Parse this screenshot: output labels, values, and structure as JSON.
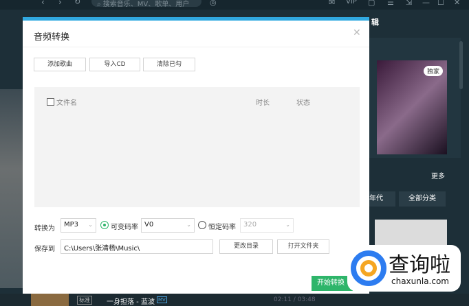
{
  "topbar": {
    "search_placeholder": "搜索音乐、MV、歌单、用户",
    "vip": "VIP"
  },
  "right_panel": {
    "section_title_partial": "辑",
    "badge": "独家",
    "more": "更多",
    "categories": [
      "年代",
      "全部分类"
    ]
  },
  "dialog": {
    "title": "音频转换",
    "toolbar": [
      "添加歌曲",
      "导入CD",
      "清除已勾"
    ],
    "columns": {
      "filename": "文件名",
      "duration": "时长",
      "status": "状态"
    },
    "convert_label": "转换为",
    "format": "MP3",
    "vbr_label": "可变码率",
    "vbr_value": "V0",
    "vbr_selected": true,
    "cbr_label": "恒定码率",
    "cbr_value": "320",
    "save_label": "保存到",
    "save_path": "C:\\Users\\张清杨\\Music\\",
    "change_dir": "更改目录",
    "open_folder": "打开文件夹",
    "start": "开始转换"
  },
  "player": {
    "quality": "标准",
    "song": "一身担落 - 蓝波",
    "mv": "MV",
    "time": "02:11 / 03:48"
  },
  "watermark": {
    "brand": "查询啦",
    "url": "chaxunla.com"
  },
  "colors": {
    "accent": "#31a9e1",
    "start": "#2eb56a",
    "radio_on": "#2eb56a"
  }
}
